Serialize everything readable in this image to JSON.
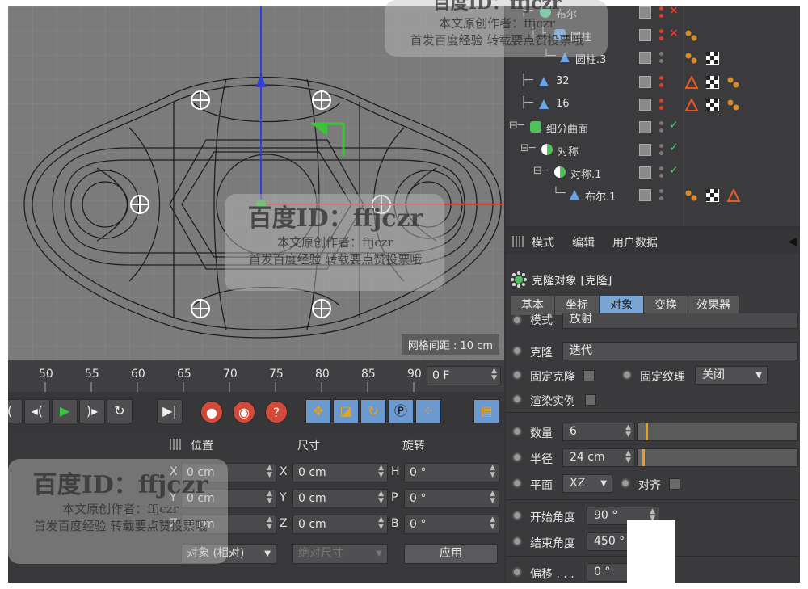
{
  "viewport": {
    "grid_spacing": "网格间距 : 10 cm"
  },
  "object_manager": {
    "rows": [
      {
        "name": "布尔",
        "state": "×"
      },
      {
        "name": "圆柱",
        "state": "×"
      },
      {
        "name": "圆柱.3",
        "state": ""
      },
      {
        "name": "32",
        "state": ""
      },
      {
        "name": "16",
        "state": ""
      },
      {
        "name": "细分曲面",
        "state": "✓"
      },
      {
        "name": "对称",
        "state": "✓"
      },
      {
        "name": "对称.1",
        "state": "✓"
      },
      {
        "name": "布尔.1",
        "state": ""
      }
    ]
  },
  "attributes": {
    "menu": [
      "模式",
      "编辑",
      "用户数据"
    ],
    "object_title": "克隆对象 [克隆]",
    "tabs": [
      "基本",
      "坐标",
      "对象",
      "变换",
      "效果器"
    ],
    "active_tab": "对象",
    "mode_label": "模式",
    "mode_value": "放射",
    "clone_label": "克隆",
    "clone_value": "迭代",
    "fixed_clone_label": "固定克隆",
    "fixed_texture_label": "固定纹理",
    "fixed_texture_value": "关闭",
    "render_instance_label": "渲染实例",
    "count_label": "数量",
    "count_value": "6",
    "count_fraction": 0.05,
    "radius_label": "半径",
    "radius_value": "24 cm",
    "radius_fraction": 0.03,
    "plane_label": "平面",
    "plane_value": "XZ",
    "align_label": "对齐",
    "start_angle_label": "开始角度",
    "start_angle_value": "90 °",
    "end_angle_label": "结束角度",
    "end_angle_value": "450 °",
    "offset_label": "偏移 . . .",
    "offset_value": "0 °"
  },
  "timeline": {
    "ticks": [
      "50",
      "55",
      "60",
      "65",
      "70",
      "75",
      "80",
      "85",
      "90"
    ],
    "frame_value": "0 F"
  },
  "coordinates": {
    "headers": [
      "位置",
      "尺寸",
      "旋转"
    ],
    "position": [
      {
        "axis": "X",
        "value": "0 cm"
      },
      {
        "axis": "Y",
        "value": "0 cm"
      },
      {
        "axis": "Z",
        "value": "0 cm"
      }
    ],
    "size": [
      {
        "axis": "X",
        "value": "0 cm"
      },
      {
        "axis": "Y",
        "value": "0 cm"
      },
      {
        "axis": "Z",
        "value": "0 cm"
      }
    ],
    "rotation": [
      {
        "axis": "H",
        "value": "0 °"
      },
      {
        "axis": "P",
        "value": "0 °"
      },
      {
        "axis": "B",
        "value": "0 °"
      }
    ],
    "mode_dropdown": "对象 (相对)",
    "size_dropdown": "绝对尺寸",
    "apply_label": "应用"
  },
  "watermark": {
    "title": "百度ID：ffjczr",
    "line1": "本文原创作者：ffjczr",
    "line2": "首发百度经验 转载要点赞投票哦",
    "top_line1": "本文原创作者：ffjczr",
    "top_line2": "首发百度经验 转载要点赞投票哦",
    "top_title": "百度ID：ffjczr"
  },
  "colors": {
    "accent_blue": "#7aa6d6",
    "slider_knob": "#e8a21a",
    "axis_red": "#e23b2e",
    "axis_green": "#3cc23c",
    "axis_blue": "#2f3fe0"
  }
}
